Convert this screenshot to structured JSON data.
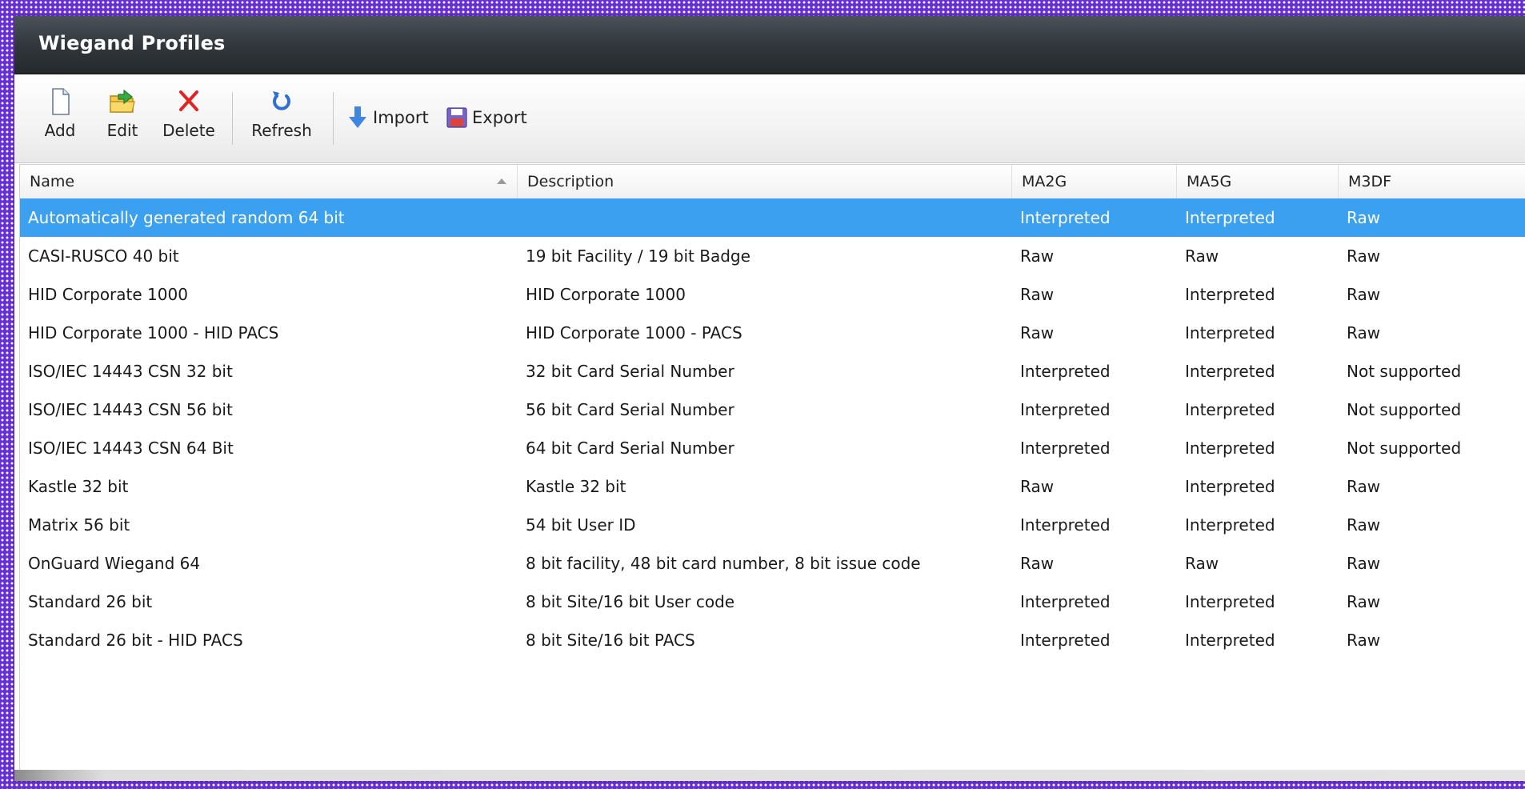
{
  "window": {
    "title": "Wiegand Profiles"
  },
  "toolbar": {
    "add_label": "Add",
    "edit_label": "Edit",
    "delete_label": "Delete",
    "refresh_label": "Refresh",
    "import_label": "Import",
    "export_label": "Export",
    "icons": {
      "add": "new-document-icon",
      "edit": "folder-edit-icon",
      "delete": "red-x-icon",
      "refresh": "refresh-icon",
      "import": "down-arrow-import-icon",
      "export": "floppy-disk-export-icon"
    }
  },
  "grid": {
    "columns": [
      "Name",
      "Description",
      "MA2G",
      "MA5G",
      "M3DF"
    ],
    "sort": {
      "column": "Name",
      "direction": "ascending"
    },
    "selected_row": 0,
    "colors": {
      "selection": "#3ba0f0",
      "title_bar": "#2f353a"
    },
    "rows": [
      {
        "name": "Automatically generated random 64 bit",
        "description": "",
        "ma2g": "Interpreted",
        "ma5g": "Interpreted",
        "m3df": "Raw"
      },
      {
        "name": "CASI-RUSCO 40 bit",
        "description": "19 bit Facility / 19 bit Badge",
        "ma2g": "Raw",
        "ma5g": "Raw",
        "m3df": "Raw"
      },
      {
        "name": "HID Corporate 1000",
        "description": "HID Corporate 1000",
        "ma2g": "Raw",
        "ma5g": "Interpreted",
        "m3df": "Raw"
      },
      {
        "name": "HID Corporate 1000 - HID PACS",
        "description": "HID Corporate 1000 - PACS",
        "ma2g": "Raw",
        "ma5g": "Interpreted",
        "m3df": "Raw"
      },
      {
        "name": "ISO/IEC 14443 CSN 32 bit",
        "description": "32 bit Card Serial Number",
        "ma2g": "Interpreted",
        "ma5g": "Interpreted",
        "m3df": "Not supported"
      },
      {
        "name": "ISO/IEC 14443 CSN 56 bit",
        "description": "56 bit Card Serial Number",
        "ma2g": "Interpreted",
        "ma5g": "Interpreted",
        "m3df": "Not supported"
      },
      {
        "name": "ISO/IEC 14443 CSN 64 Bit",
        "description": "64 bit Card Serial Number",
        "ma2g": "Interpreted",
        "ma5g": "Interpreted",
        "m3df": "Not supported"
      },
      {
        "name": "Kastle 32 bit",
        "description": "Kastle 32 bit",
        "ma2g": "Raw",
        "ma5g": "Interpreted",
        "m3df": "Raw"
      },
      {
        "name": "Matrix 56 bit",
        "description": "54 bit User ID",
        "ma2g": "Interpreted",
        "ma5g": "Interpreted",
        "m3df": "Raw"
      },
      {
        "name": "OnGuard Wiegand 64",
        "description": "8 bit facility, 48 bit card number, 8 bit issue code",
        "ma2g": "Raw",
        "ma5g": "Raw",
        "m3df": "Raw"
      },
      {
        "name": "Standard 26 bit",
        "description": "8 bit Site/16 bit User code",
        "ma2g": "Interpreted",
        "ma5g": "Interpreted",
        "m3df": "Raw"
      },
      {
        "name": "Standard 26 bit - HID PACS",
        "description": "8 bit Site/16 bit PACS",
        "ma2g": "Interpreted",
        "ma5g": "Interpreted",
        "m3df": "Raw"
      }
    ]
  }
}
